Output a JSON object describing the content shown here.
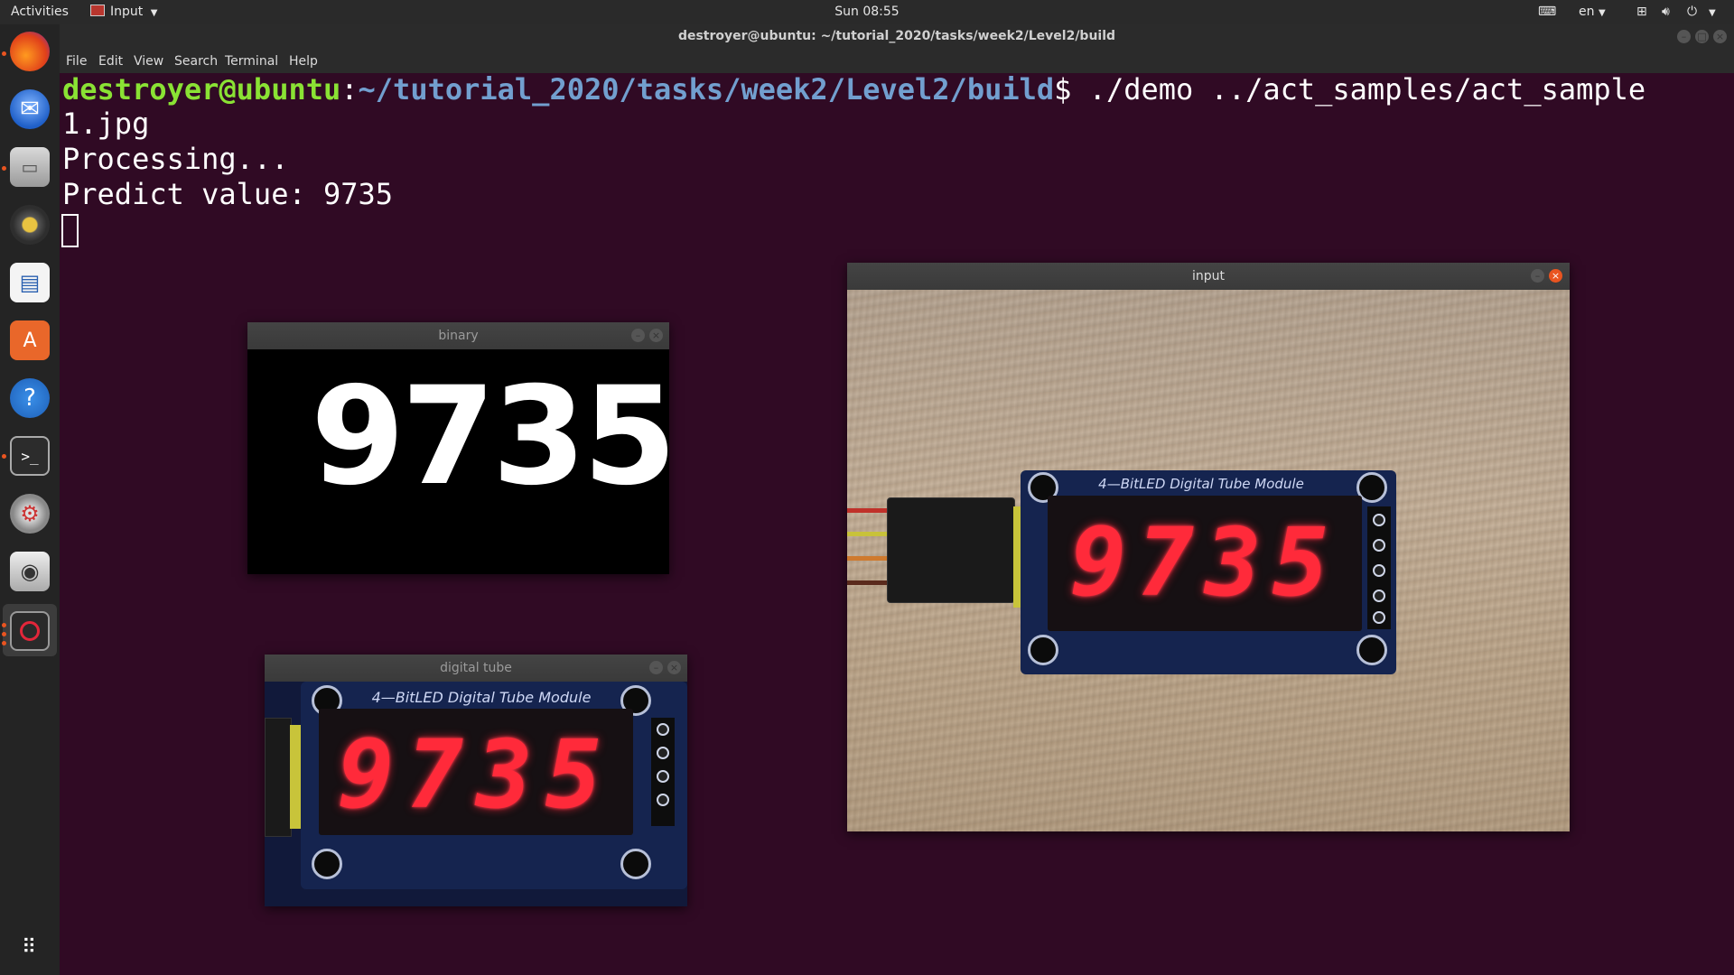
{
  "topbar": {
    "activities": "Activities",
    "app_menu": "Input",
    "clock": "Sun 08:55",
    "language": "en"
  },
  "terminal": {
    "title": "destroyer@ubuntu: ~/tutorial_2020/tasks/week2/Level2/build",
    "menu": [
      "File",
      "Edit",
      "View",
      "Search",
      "Terminal",
      "Help"
    ],
    "prompt_user": "destroyer@ubuntu",
    "prompt_path": "~/tutorial_2020/tasks/week2/Level2/build",
    "prompt_command": "$ ./demo ../act_samples/act_sample",
    "line2": "1.jpg",
    "line3": "Processing...",
    "line4": "Predict value: 9735"
  },
  "windows": {
    "binary": {
      "title": "binary",
      "digits": "9735"
    },
    "digital_tube": {
      "title": "digital tube",
      "label": "4—BitLED  Digital  Tube  Module",
      "digits": "9735"
    },
    "input": {
      "title": "input",
      "label": "4—BitLED  Digital  Tube  Module",
      "digits": "9735"
    }
  },
  "dock": {
    "icons": [
      "firefox-icon",
      "thunderbird-icon",
      "files-icon",
      "rhythmbox-icon",
      "writer-icon",
      "software-icon",
      "help-icon",
      "terminal-icon",
      "settings-icon",
      "screenshot-icon",
      "input-app-icon",
      "show-apps-icon"
    ]
  }
}
